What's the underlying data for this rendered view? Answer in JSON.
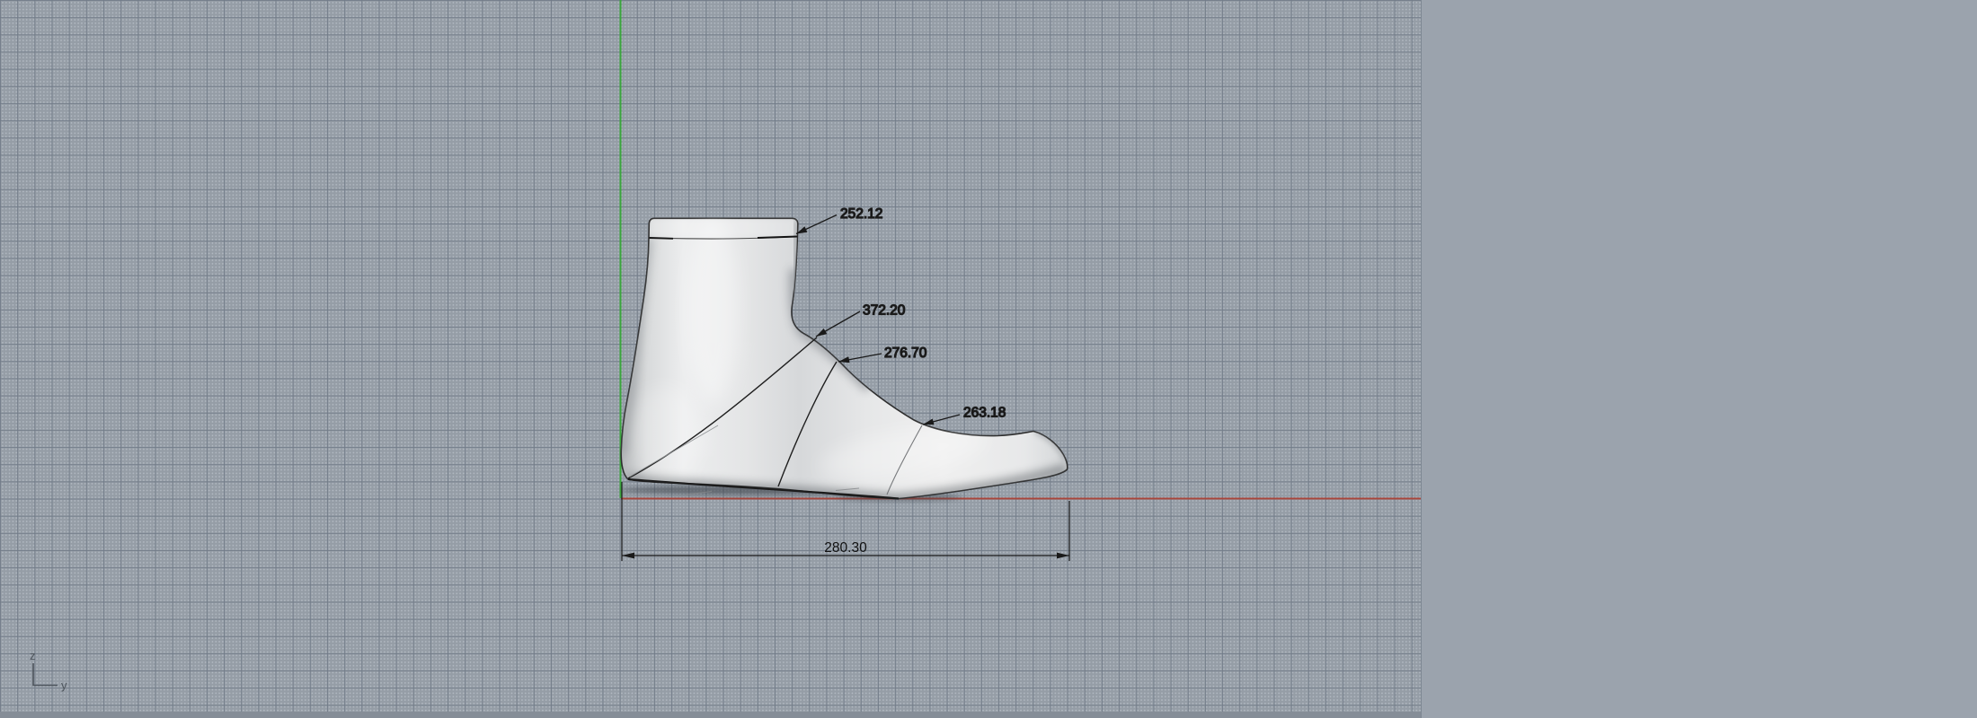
{
  "viewport": {
    "axis_indicator": {
      "vertical_label": "z",
      "horizontal_label": "y"
    },
    "annotations": {
      "leaders": [
        {
          "label": "252.12"
        },
        {
          "label": "372.20"
        },
        {
          "label": "276.70"
        },
        {
          "label": "263.18"
        }
      ],
      "linear_dimension": {
        "label": "280.30"
      }
    },
    "colors": {
      "grid_background": "#959da6",
      "panel_background": "#9ba3ad",
      "grid_major_line": "#717b88",
      "axis_vertical_green": "#3aa53c",
      "axis_horizontal_red": "#a8463c",
      "annotation_ink": "#111111",
      "model_light": "#ececed",
      "model_dark": "#b3b6b8"
    }
  }
}
